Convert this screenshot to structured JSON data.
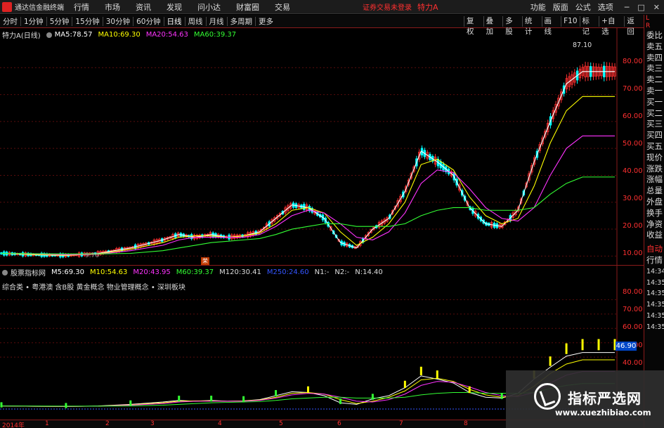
{
  "titlebar": {
    "app_title": "通达信金融终端",
    "menus": [
      "行情",
      "市场",
      "资讯",
      "发现",
      "问小达",
      "财富圈",
      "交易"
    ],
    "login_status": "证券交易未登录",
    "stock_name": "特力A",
    "right_menus": [
      "功能",
      "版面",
      "公式",
      "选项"
    ],
    "window_buttons": [
      "─",
      "□",
      "✕"
    ]
  },
  "toolbar": {
    "periods": [
      "分时",
      "1分钟",
      "5分钟",
      "15分钟",
      "30分钟",
      "60分钟",
      "日线",
      "周线",
      "月线",
      "多周期",
      "更多"
    ],
    "active_period": "日线",
    "right_buttons": [
      "复权",
      "叠加",
      "多股",
      "统计",
      "画线",
      "F10",
      "标记",
      "+自选",
      "返回"
    ]
  },
  "side_panel": {
    "top_label": "L",
    "top_label_sub": "R",
    "items": [
      "委比",
      "卖五",
      "卖四",
      "卖三",
      "卖二",
      "卖一",
      "买一",
      "买二",
      "买三",
      "买四",
      "买五",
      "现价",
      "涨跌",
      "涨幅",
      "总量",
      "外盘",
      "换手",
      "净资",
      "收益"
    ],
    "auto": "自动",
    "market": "行情",
    "times": [
      "14:34",
      "14:35",
      "14:35",
      "14:35",
      "14:35",
      "14:35",
      "14:35",
      "14:35"
    ]
  },
  "main_legend": {
    "stock": "特力A(日线)",
    "ma": [
      {
        "label": "MA5:",
        "value": "78.57",
        "color": "#ffffff"
      },
      {
        "label": "MA10:",
        "value": "69.30",
        "color": "#ffff00"
      },
      {
        "label": "MA20:",
        "value": "54.63",
        "color": "#ff33ff"
      },
      {
        "label": "MA60:",
        "value": "39.37",
        "color": "#33ff33"
      }
    ]
  },
  "indicator_legend": {
    "name": "股票指标网",
    "lines": [
      {
        "label": "M5:",
        "value": "69.30",
        "color": "#ffffff"
      },
      {
        "label": "M10:",
        "value": "54.63",
        "color": "#ffff00"
      },
      {
        "label": "M20:",
        "value": "43.95",
        "color": "#ff33ff"
      },
      {
        "label": "M60:",
        "value": "39.37",
        "color": "#33ff33"
      },
      {
        "label": "M120:",
        "value": "30.41",
        "color": "#dddddd"
      },
      {
        "label": "M250:",
        "value": "24.60",
        "color": "#3355ff"
      },
      {
        "label": "N1:",
        "value": "-",
        "color": "#dddddd"
      },
      {
        "label": "N2:",
        "value": "-",
        "color": "#dddddd"
      },
      {
        "label": "N:",
        "value": "14.40",
        "color": "#dddddd"
      }
    ]
  },
  "concepts": "综合类 • 粤港澳 含B股 黄金概念 物业管理概念 • 深圳板块",
  "price_axis": [
    "80.00",
    "70.00",
    "60.00",
    "50.00",
    "40.00",
    "30.00",
    "20.00",
    "10.00"
  ],
  "indicator_axis": [
    "80.00",
    "70.00",
    "60.00",
    "50.00",
    "40.00"
  ],
  "markers": {
    "max_price": "87.10",
    "min_price": "9.70",
    "event_badge": "荣",
    "current_tag": "46.90"
  },
  "date_axis": [
    "2014年",
    "1",
    "2",
    "3",
    "4",
    "5",
    "6",
    "7",
    "8"
  ],
  "watermark": {
    "title": "指标严选网",
    "url": "www.xuezhibiao.com"
  },
  "colors": {
    "up": "#ff3030",
    "down": "#00ffff",
    "ma5": "#ffffff",
    "ma10": "#ffff00",
    "ma20": "#ff33ff",
    "ma60": "#33ff33",
    "border": "#8a1a1a"
  },
  "chart_data": {
    "type": "line",
    "x": [
      0,
      10,
      20,
      30,
      40,
      50,
      55,
      60,
      65,
      70,
      75,
      80,
      85,
      90,
      95,
      100,
      105,
      110,
      115,
      120,
      125,
      130,
      135,
      140,
      145,
      150,
      155,
      160,
      165,
      170,
      175,
      180,
      185,
      190
    ],
    "series": [
      {
        "name": "MA5",
        "values": [
          11,
          10.5,
          10.2,
          11,
          13,
          16,
          18,
          17,
          18,
          17,
          17.5,
          19,
          24,
          29,
          28,
          24,
          15,
          13,
          20,
          24,
          34,
          49,
          45,
          40,
          28,
          22,
          21,
          27,
          45,
          60,
          74,
          78.57,
          78.57,
          78.57
        ]
      },
      {
        "name": "MA10",
        "values": [
          11,
          10.6,
          10.3,
          10.8,
          12.5,
          15,
          17,
          17.5,
          17.5,
          17,
          17.5,
          18.5,
          22,
          27,
          28,
          26,
          19,
          14,
          17,
          22,
          30,
          44,
          46,
          42,
          32,
          25,
          22,
          24,
          36,
          52,
          64,
          69.3,
          69.3,
          69.3
        ]
      },
      {
        "name": "MA20",
        "values": [
          11,
          10.8,
          10.5,
          10.7,
          12,
          14,
          16,
          17,
          17,
          17,
          17,
          18,
          21,
          25,
          27,
          26,
          22,
          17,
          16,
          19,
          26,
          37,
          42,
          41,
          35,
          28,
          24,
          23,
          28,
          40,
          50,
          54.63,
          54.63,
          54.63
        ]
      },
      {
        "name": "MA60",
        "values": [
          11,
          10.9,
          10.8,
          10.8,
          11,
          12,
          13,
          14,
          15,
          15.5,
          16,
          16.5,
          18,
          20,
          21,
          22,
          22,
          21,
          21,
          21,
          22,
          25,
          27,
          28,
          28,
          27,
          27,
          27,
          28,
          33,
          37,
          39.37,
          39.37,
          39.37
        ]
      }
    ],
    "ylim": [
      8,
      90
    ]
  }
}
